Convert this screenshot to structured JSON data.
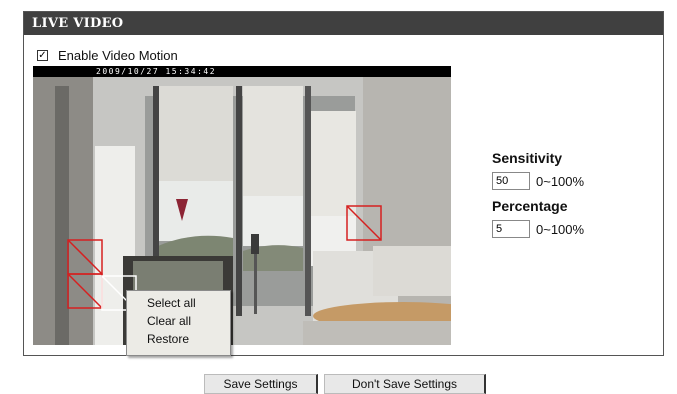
{
  "header": {
    "title": "LIVE VIDEO"
  },
  "motion": {
    "enabled": true,
    "checkbox_mark": "✓",
    "label": "Enable Video Motion"
  },
  "video": {
    "timestamp": "2009/10/27 15:34:42"
  },
  "settings": {
    "sensitivity": {
      "label": "Sensitivity",
      "value": "50",
      "range": "0~100%"
    },
    "percentage": {
      "label": "Percentage",
      "value": "5",
      "range": "0~100%"
    }
  },
  "context_menu": {
    "items": [
      "Select all",
      "Clear all",
      "Restore"
    ]
  },
  "buttons": {
    "save": "Save Settings",
    "dont_save": "Don't Save Settings"
  },
  "colors": {
    "header_bg": "#404040",
    "region_marker": "#d62020",
    "selected_marker": "#ffffff"
  }
}
